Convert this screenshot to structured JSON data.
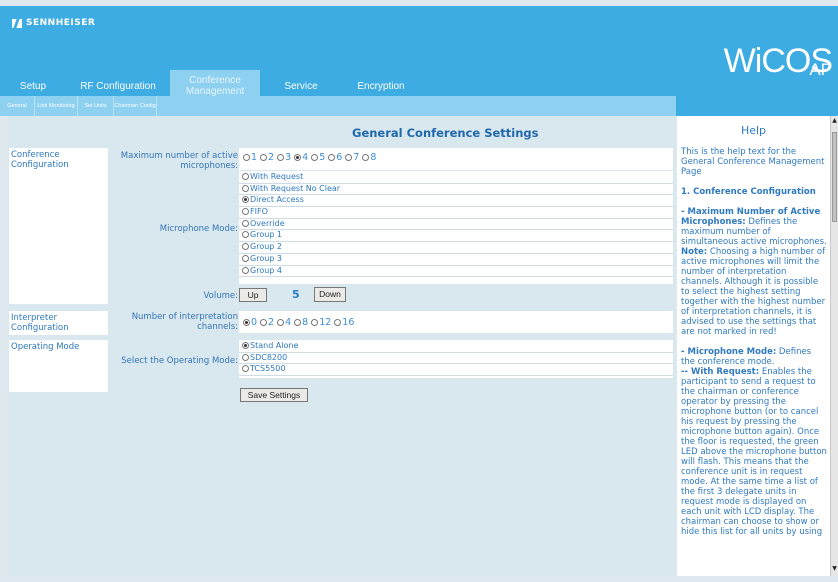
{
  "header": {
    "logo_text": "SENNHEISER",
    "brand_main": "WiCOS",
    "brand_sub": "AP"
  },
  "tabs": [
    {
      "label": "Setup",
      "active": false
    },
    {
      "label": "RF Configuration",
      "active": false
    },
    {
      "label": "Conference Management",
      "active": true
    },
    {
      "label": "Service",
      "active": false
    },
    {
      "label": "Encryption",
      "active": false
    }
  ],
  "subtabs": [
    {
      "label": "General"
    },
    {
      "label": "Link Monitoring"
    },
    {
      "label": "Set Units"
    },
    {
      "label": "Chairman Config"
    }
  ],
  "page_title": "General Conference Settings",
  "sections": {
    "conference": "Conference Configuration",
    "interpreter": "Interpreter Configuration",
    "operating": "Operating Mode"
  },
  "labels": {
    "max_mics": "Maximum number of active microphones:",
    "mic_mode": "Microphone Mode:",
    "volume": "Volume:",
    "interp_channels": "Number of interpretation channels:",
    "op_mode": "Select the Operating Mode:"
  },
  "max_mics": {
    "options": [
      "1",
      "2",
      "3",
      "4",
      "5",
      "6",
      "7",
      "8"
    ],
    "selected": "4"
  },
  "mic_mode": {
    "options": [
      "With Request",
      "With Request No Clear",
      "Direct Access",
      "FIFO",
      "Override",
      "Group 1",
      "Group 2",
      "Group 3",
      "Group 4"
    ],
    "selected": "Direct Access"
  },
  "volume": {
    "up_label": "Up",
    "value": "5",
    "down_label": "Down"
  },
  "interp_channels": {
    "options": [
      "0",
      "2",
      "4",
      "8",
      "12",
      "16"
    ],
    "selected": "0"
  },
  "op_mode": {
    "options": [
      "Stand Alone",
      "SDC8200",
      "TCS5500"
    ],
    "selected": "Stand Alone"
  },
  "save_label": "Save Settings",
  "help": {
    "title": "Help",
    "intro": "This is the help text for the General Conference Management Page",
    "sec1": "1. Conference Configuration",
    "max_head": "- Maximum Number of Active Microphones:",
    "max_text": " Defines the maximum number of simultaneous active microphones.",
    "note_head": "Note:",
    "note_text": " Choosing a high number of active microphones will limit the number of interpretation channels. Although it is possible to select the highest setting together with the highest number of interpretation channels, it is advised to use the settings that are not marked in red!",
    "mode_head": "- Microphone Mode:",
    "mode_text": " Defines the conference mode.",
    "req_head": "-- With Request:",
    "req_text": " Enables the participant to send a request to the chairman or conference operator by pressing the microphone button (or to cancel his request by pressing the microphone button again). Once the floor is requested, the green LED above the microphone button will flash. This means that the conference unit is in request mode. At the same time a list of the first 3 delegate units in request mode is displayed on each unit with LCD display. The chairman can choose to show or hide this list for all units by using"
  }
}
